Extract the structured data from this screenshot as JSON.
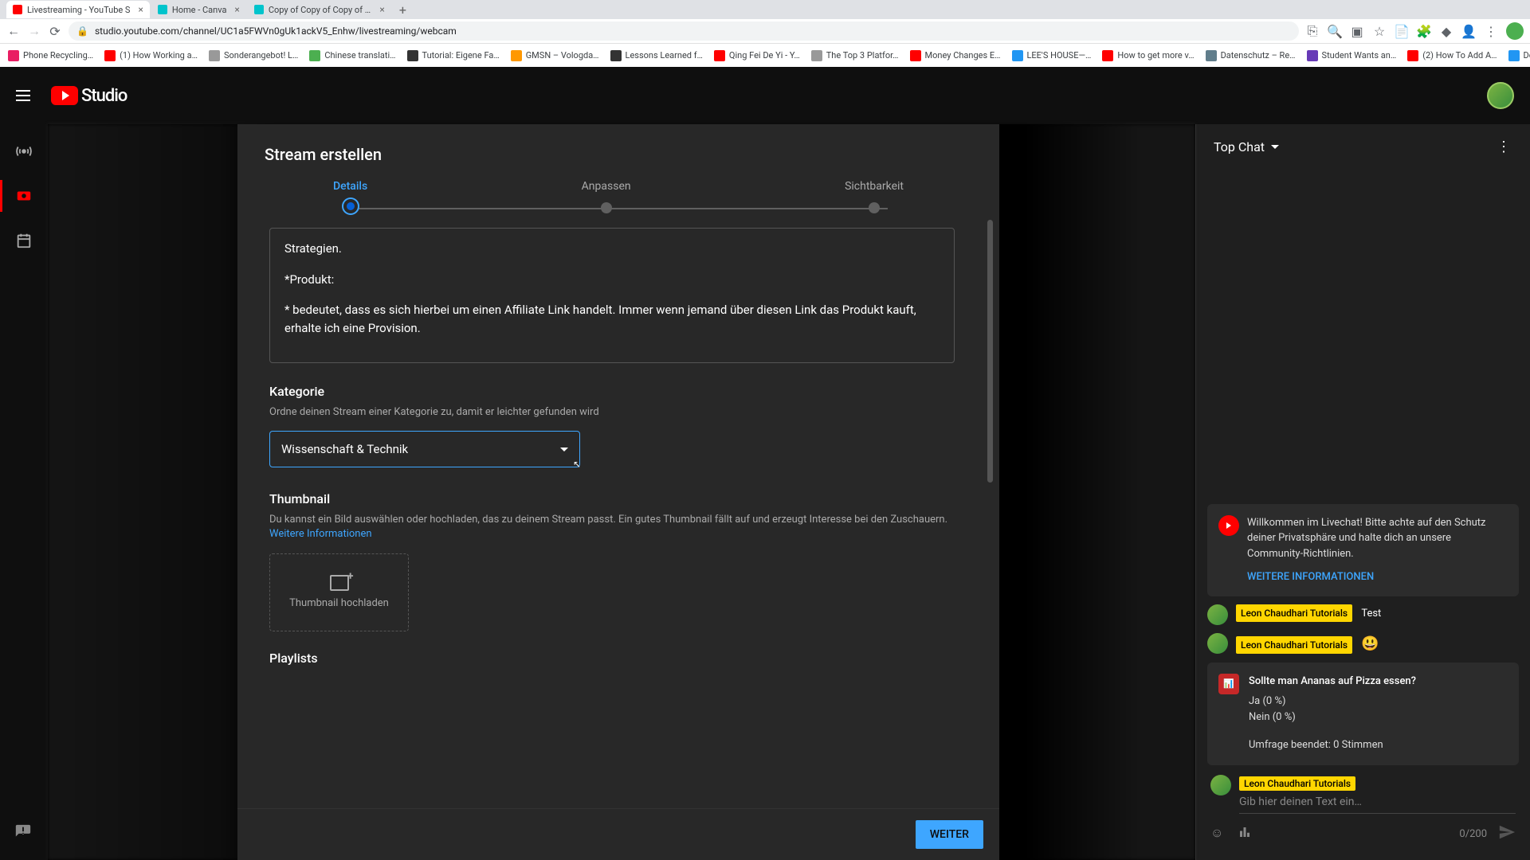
{
  "browser": {
    "tabs": [
      {
        "title": "Livestreaming - YouTube S",
        "favicon": "#f00"
      },
      {
        "title": "Home - Canva",
        "favicon": "#00c4cc"
      },
      {
        "title": "Copy of Copy of Copy of Cop",
        "favicon": "#00c4cc"
      }
    ],
    "url": "studio.youtube.com/channel/UC1a5FWVn0gUk1ackV5_Enhw/livestreaming/webcam",
    "bookmarks": [
      "Phone Recycling…",
      "(1) How Working a…",
      "Sonderangebot! L…",
      "Chinese translati…",
      "Tutorial: Eigene Fa…",
      "GMSN – Vologda…",
      "Lessons Learned f…",
      "Qing Fei De Yi - Y…",
      "The Top 3 Platfor…",
      "Money Changes E…",
      "LEE'S HOUSE—…",
      "How to get more v…",
      "Datenschutz – Re…",
      "Student Wants an…",
      "(2) How To Add A…",
      "Download - Cooki…"
    ]
  },
  "logo_text": "Studio",
  "modal": {
    "title": "Stream erstellen",
    "steps": [
      "Details",
      "Anpassen",
      "Sichtbarkeit"
    ],
    "description": {
      "line1": "Strategien.",
      "line2": "*Produkt:",
      "line3": "* bedeutet, dass es sich hierbei um einen Affiliate Link handelt. Immer wenn jemand über diesen Link das Produkt kauft, erhalte ich eine Provision."
    },
    "category": {
      "title": "Kategorie",
      "hint": "Ordne deinen Stream einer Kategorie zu, damit er leichter gefunden wird",
      "value": "Wissenschaft & Technik"
    },
    "thumbnail": {
      "title": "Thumbnail",
      "hint": "Du kannst ein Bild auswählen oder hochladen, das zu deinem Stream passt. Ein gutes Thumbnail fällt auf und erzeugt Interesse bei den Zuschauern. ",
      "link": "Weitere Informationen",
      "upload": "Thumbnail hochladen"
    },
    "playlists_title": "Playlists",
    "next_button": "WEITER"
  },
  "chat": {
    "title": "Top Chat",
    "welcome": {
      "text": "Willkommen im Livechat! Bitte achte auf den Schutz deiner Privatsphäre und halte dich an unsere Community-Richtlinien.",
      "link": "WEITERE INFORMATIONEN"
    },
    "author": "Leon Chaudhari Tutorials",
    "msg_test": "Test",
    "msg_emoji": "😃",
    "poll": {
      "question": "Sollte man Ananas auf Pizza essen?",
      "opt1": "Ja (0 %)",
      "opt2": "Nein (0 %)",
      "ended": "Umfrage beendet: 0 Stimmen"
    },
    "input_placeholder": "Gib hier deinen Text ein…",
    "char_count": "0/200"
  }
}
